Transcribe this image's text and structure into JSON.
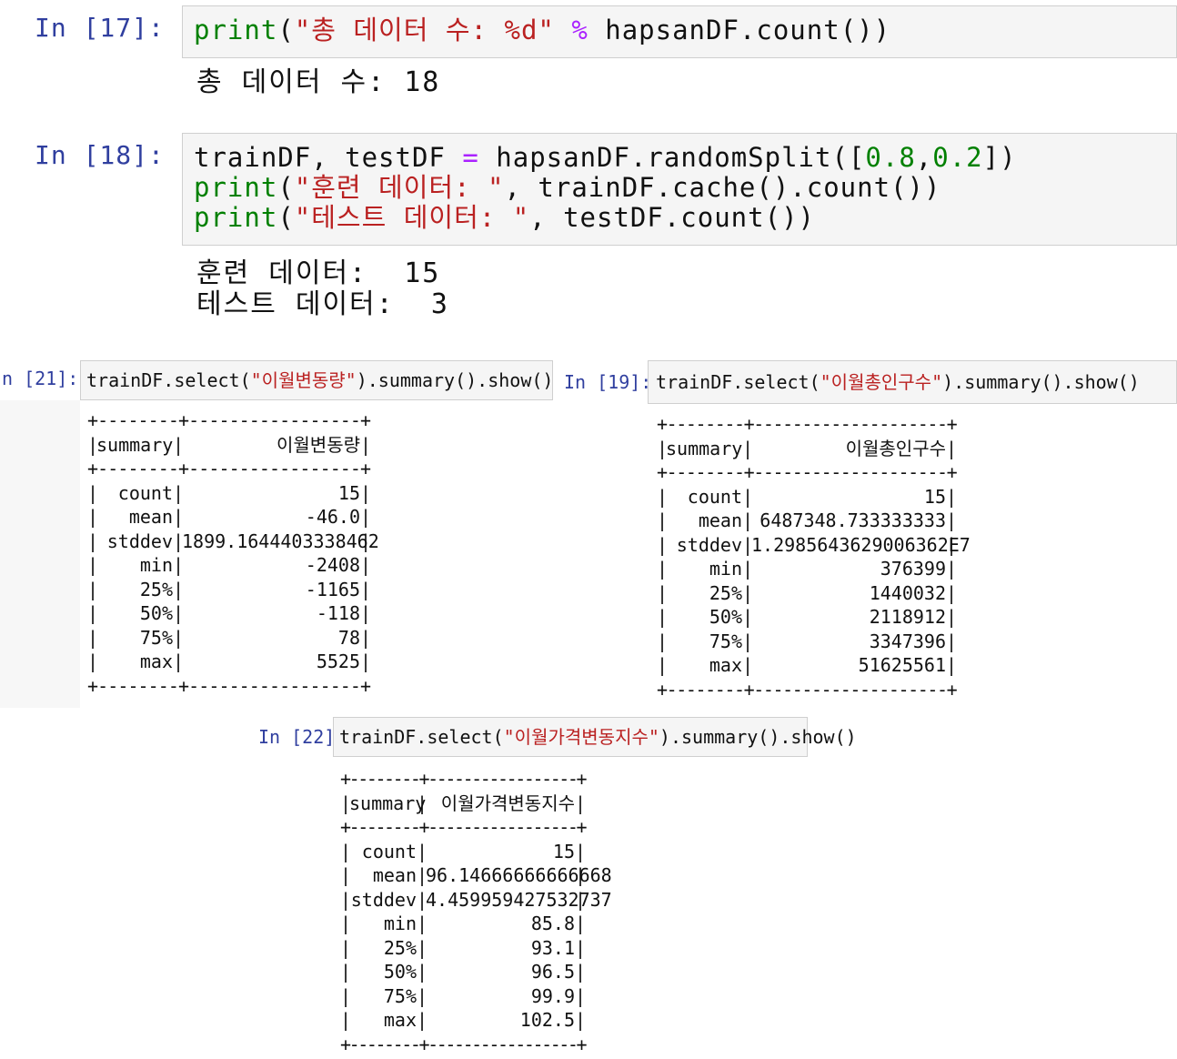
{
  "cell17": {
    "prompt": "In [17]:",
    "code": {
      "kw": "print",
      "open": "(",
      "str": "\"총 데이터 수: %d\"",
      "op": "%",
      "rest": " hapsanDF.count())"
    },
    "output": "총 데이터 수: 18"
  },
  "cell18": {
    "prompt": "In [18]:",
    "line1": {
      "pre": "trainDF, testDF ",
      "op": "=",
      "mid": " hapsanDF.randomSplit([",
      "n1": "0.8",
      "comma": ",",
      "n2": "0.2",
      "end": "])"
    },
    "line2": {
      "kw": "print",
      "open": "(",
      "str": "\"훈련 데이터: \"",
      "rest": ", trainDF.cache().count())"
    },
    "line3": {
      "kw": "print",
      "open": "(",
      "str": "\"테스트 데이터: \"",
      "rest": ", testDF.count())"
    },
    "output1": "훈련 데이터:  15",
    "output2": "테스트 데이터:  3"
  },
  "cell21": {
    "prompt": "n [21]:",
    "code": {
      "pre": "trainDF.select(",
      "str": "\"이월변동량\"",
      "post": ").summary().show()"
    },
    "table": {
      "separator": "+--------+-----------------+",
      "header": [
        "summary",
        "이월변동량"
      ],
      "rows": [
        [
          "count",
          "15"
        ],
        [
          "mean",
          "-46.0"
        ],
        [
          "stddev",
          "1899.1644403338462"
        ],
        [
          "min",
          "-2408"
        ],
        [
          "25%",
          "-1165"
        ],
        [
          "50%",
          "-118"
        ],
        [
          "75%",
          "78"
        ],
        [
          "max",
          "5525"
        ]
      ]
    }
  },
  "cell19": {
    "prompt": "In [19]:",
    "code": {
      "pre": "trainDF.select(",
      "str": "\"이월총인구수\"",
      "post": ").summary().show()"
    },
    "table": {
      "separator": "+--------+--------------------+",
      "header": [
        "summary",
        "이월총인구수"
      ],
      "rows": [
        [
          "count",
          "15"
        ],
        [
          "mean",
          "6487348.733333333"
        ],
        [
          "stddev",
          "1.2985643629006362E7"
        ],
        [
          "min",
          "376399"
        ],
        [
          "25%",
          "1440032"
        ],
        [
          "50%",
          "2118912"
        ],
        [
          "75%",
          "3347396"
        ],
        [
          "max",
          "51625561"
        ]
      ]
    }
  },
  "cell22": {
    "prompt": "In [22]:",
    "code": {
      "pre": "trainDF.select(",
      "str": "\"이월가격변동지수\"",
      "post": ").summary().show()"
    },
    "table": {
      "separator": "+--------+-----------------+",
      "header": [
        "summary",
        "이월가격변동지수"
      ],
      "rows": [
        [
          "count",
          "15"
        ],
        [
          "mean",
          "96.14666666666668"
        ],
        [
          "stddev",
          "4.459959427532737"
        ],
        [
          "min",
          "85.8"
        ],
        [
          "25%",
          "93.1"
        ],
        [
          "50%",
          "96.5"
        ],
        [
          "75%",
          "99.9"
        ],
        [
          "max",
          "102.5"
        ]
      ]
    }
  },
  "colors": {
    "prompt": "#303f9f",
    "keyword": "#008000",
    "string": "#ba2121",
    "operator": "#aa22ff",
    "input_bg": "#f5f5f5"
  }
}
